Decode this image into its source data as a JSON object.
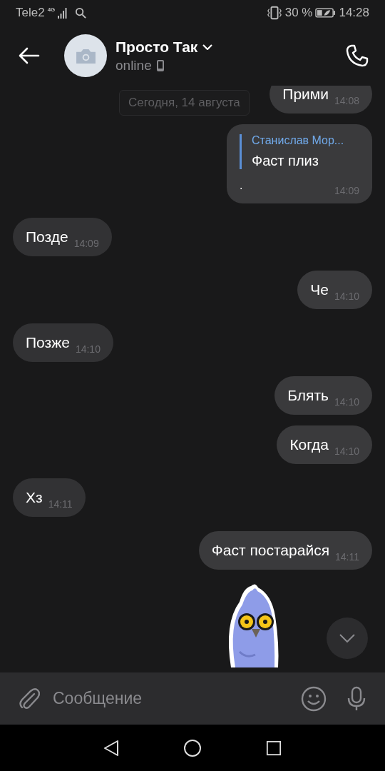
{
  "status_bar": {
    "carrier": "Tele2",
    "network": "4G",
    "battery": "30 %",
    "time": "14:28"
  },
  "header": {
    "title": "Просто Так",
    "status": "online"
  },
  "date_separator": "Сегодня, 14 августа",
  "messages": [
    {
      "kind": "text",
      "outgoing": true,
      "text": "Прими",
      "time": "14:08"
    },
    {
      "kind": "reply",
      "outgoing": true,
      "reply_author": "Станислав Мор...",
      "reply_text": "Фаст плиз",
      "text": ".",
      "time": "14:09"
    },
    {
      "kind": "text",
      "outgoing": false,
      "text": "Позде",
      "time": "14:09"
    },
    {
      "kind": "text",
      "outgoing": true,
      "text": "Че",
      "time": "14:10"
    },
    {
      "kind": "text",
      "outgoing": false,
      "text": "Позже",
      "time": "14:10"
    },
    {
      "kind": "text",
      "outgoing": true,
      "text": "Блять",
      "time": "14:10"
    },
    {
      "kind": "text",
      "outgoing": true,
      "text": "Когда",
      "time": "14:10"
    },
    {
      "kind": "text",
      "outgoing": false,
      "text": "Хз",
      "time": "14:11"
    },
    {
      "kind": "text",
      "outgoing": true,
      "text": "Фаст постарайся",
      "time": "14:11"
    },
    {
      "kind": "sticker",
      "outgoing": true
    }
  ],
  "composer": {
    "placeholder": "Сообщение"
  }
}
